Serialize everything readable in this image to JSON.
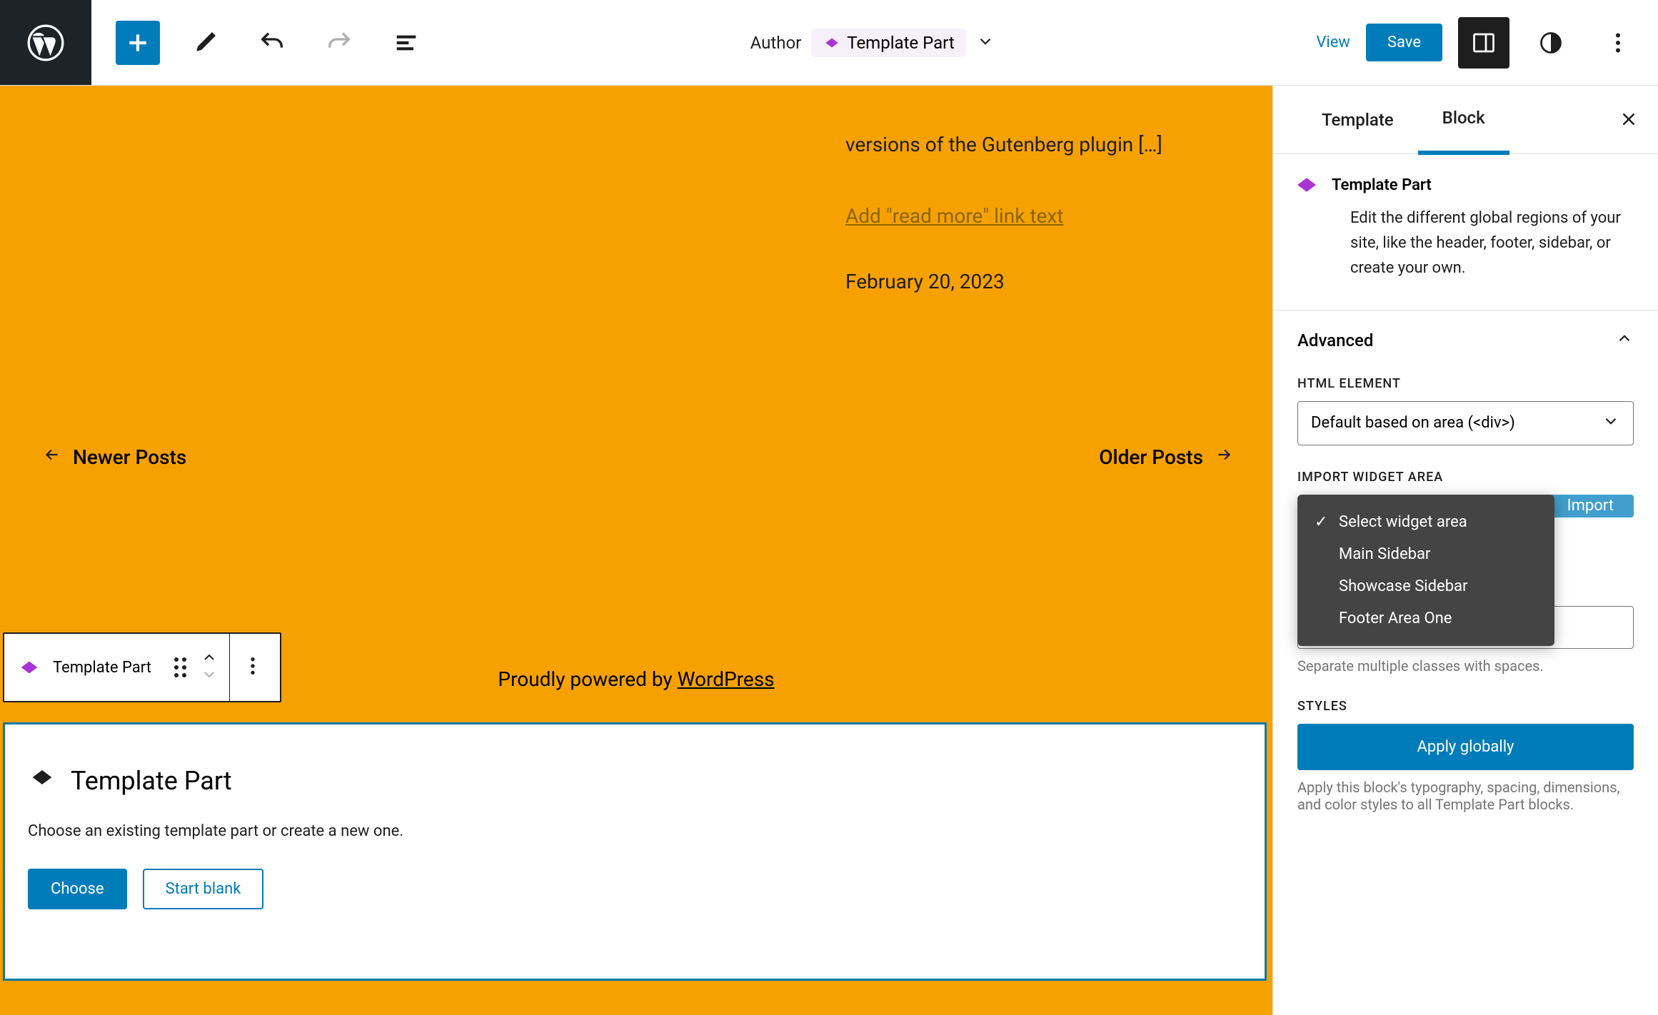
{
  "topbar": {
    "doc_label": "Author",
    "template_part_label": "Template Part",
    "view": "View",
    "save": "Save"
  },
  "canvas": {
    "excerpt": "versions of the Gutenberg plugin […]",
    "read_more": "Add \"read more\" link text",
    "post_date": "February 20, 2023",
    "newer": "Newer Posts",
    "older": "Older Posts",
    "powered_prefix": "Proudly powered by ",
    "powered_link": "WordPress",
    "toolbar_label": "Template Part",
    "placeholder": {
      "title": "Template Part",
      "desc": "Choose an existing template part or create a new one.",
      "choose": "Choose",
      "start_blank": "Start blank"
    }
  },
  "sidebar": {
    "tabs": {
      "template": "Template",
      "block": "Block"
    },
    "block_name": "Template Part",
    "block_desc": "Edit the different global regions of your site, like the header, footer, sidebar, or create your own.",
    "advanced": "Advanced",
    "html_element_label": "HTML ELEMENT",
    "html_element_value": "Default based on area (<div>)",
    "import_label": "IMPORT WIDGET AREA",
    "import_button": "Import",
    "dropdown": {
      "opt0": "Select widget area",
      "opt1": "Main Sidebar",
      "opt2": "Showcase Sidebar",
      "opt3": "Footer Area One"
    },
    "css_help": "Separate multiple classes with spaces.",
    "styles_label": "STYLES",
    "apply_globally": "Apply globally",
    "apply_help": "Apply this block's typography, spacing, dimensions, and color styles to all Template Part blocks."
  }
}
